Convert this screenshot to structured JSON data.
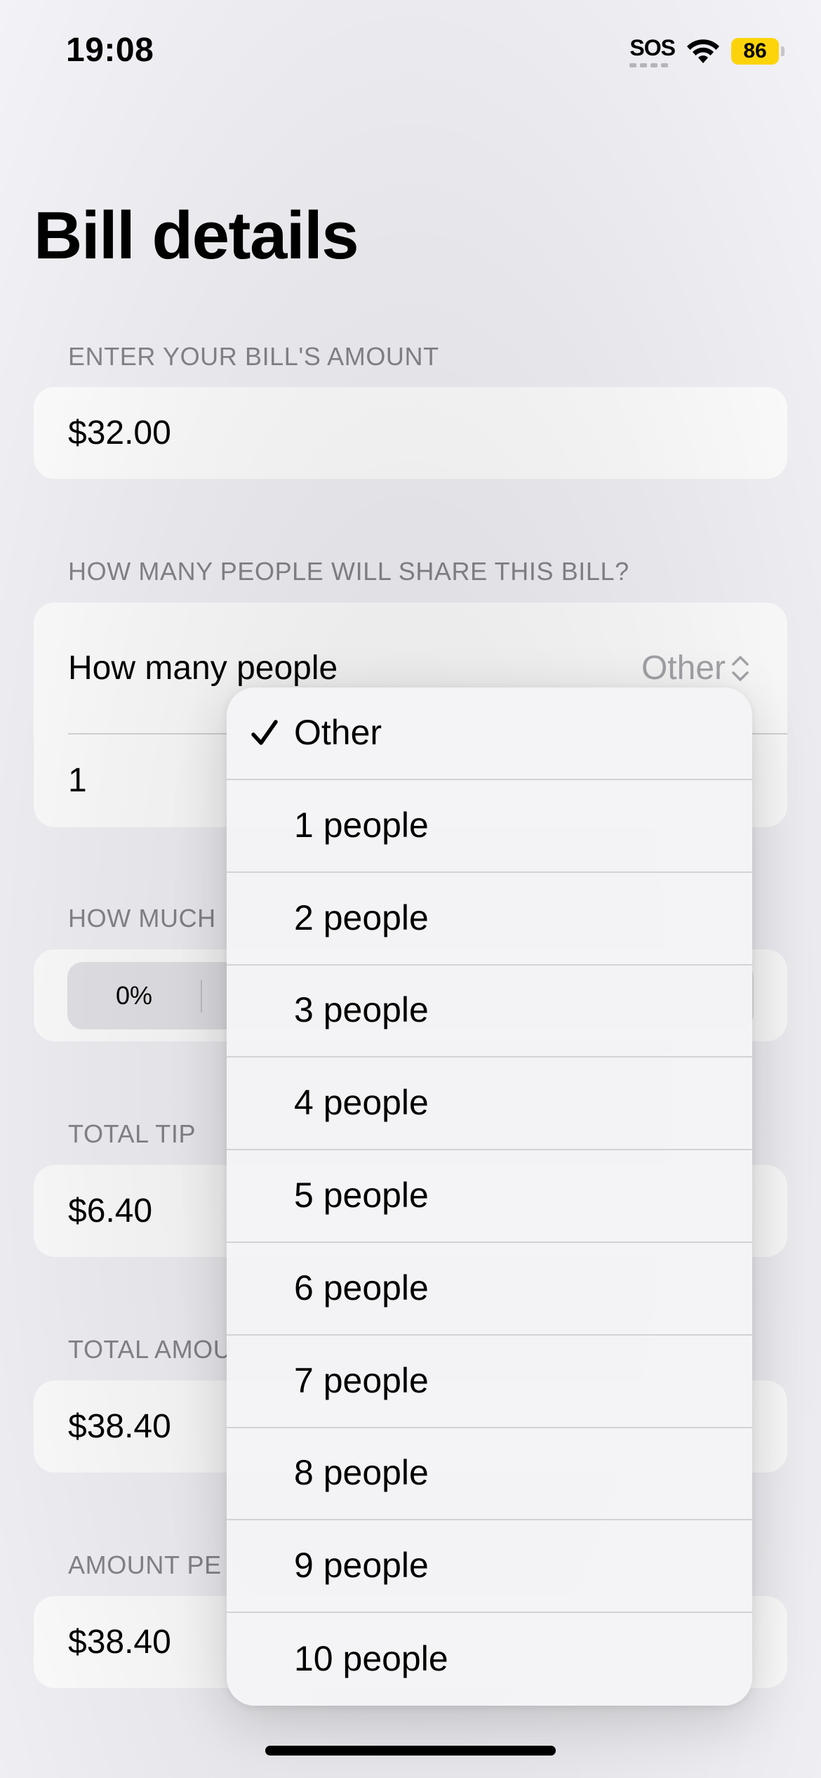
{
  "status_bar": {
    "time": "19:08",
    "sos": "SOS",
    "battery": "86",
    "icons": [
      "wifi-icon",
      "battery-icon"
    ]
  },
  "title": "Bill details",
  "bill_amount": {
    "label": "ENTER YOUR BILL'S AMOUNT",
    "value": "$32.00"
  },
  "people": {
    "label": "HOW MANY PEOPLE WILL SHARE THIS BILL?",
    "picker_label": "How many people",
    "picker_value": "Other",
    "custom_value": "1"
  },
  "tip": {
    "label": "HOW MUCH",
    "first_segment": "0%"
  },
  "total_tip": {
    "label": "TOTAL TIP",
    "value": "$6.40"
  },
  "total_amount": {
    "label": "TOTAL AMOU",
    "value": "$38.40"
  },
  "amount_per_person": {
    "label": "AMOUNT PE",
    "value": "$38.40"
  },
  "menu": {
    "selected_index": 0,
    "options": [
      "Other",
      "1 people",
      "2 people",
      "3 people",
      "4 people",
      "5 people",
      "6 people",
      "7 people",
      "8 people",
      "9 people",
      "10 people"
    ]
  }
}
